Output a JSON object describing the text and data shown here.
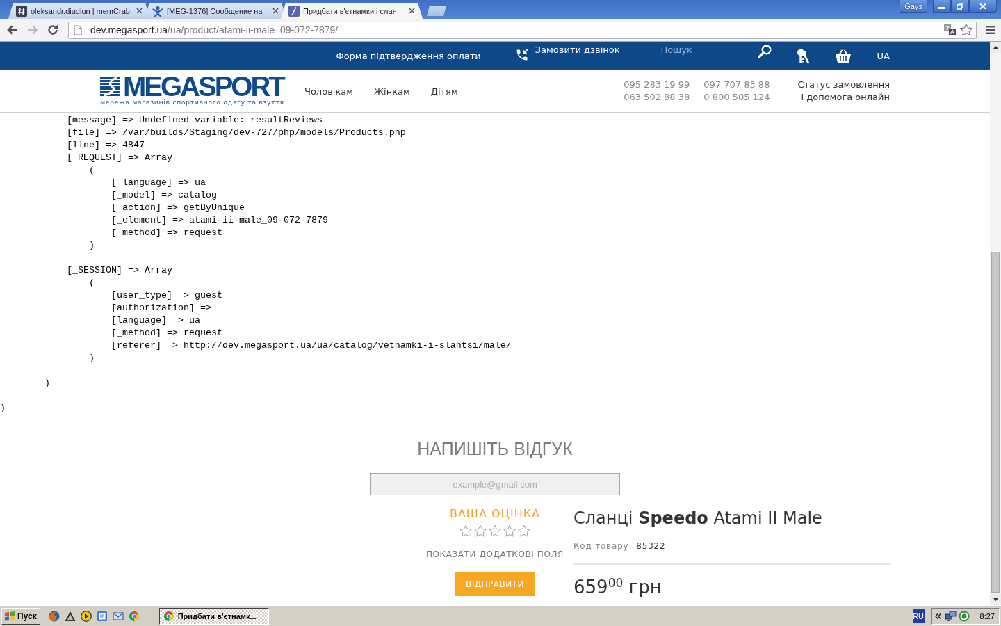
{
  "browser": {
    "tabs": [
      {
        "title": "oleksandr.diudiun | memCrab",
        "selected": false
      },
      {
        "title": "[MEG-1376] Сообщение на",
        "selected": false
      },
      {
        "title": "Придбати в'єтнамки і слан",
        "selected": true
      }
    ],
    "profile": "Gays",
    "nav_buttons": [
      {
        "kind": "back",
        "disabled": false
      },
      {
        "kind": "forward",
        "disabled": true
      },
      {
        "kind": "reload",
        "disabled": false
      }
    ],
    "address": {
      "host": "dev.megasport.ua",
      "path": "/ua/product/atami-ii-male_09-072-7879/"
    }
  },
  "site_header": {
    "top_bar": {
      "payment_form_link": "Форма підтвердження оплати",
      "callback_link": "Замовити дзвінок",
      "search": {
        "placeholder": "Пошук"
      },
      "language": "UA"
    },
    "logo": {
      "wordmark": "MEGASPORT",
      "tagline": "мережа магазинів спортивного одягу та взуття"
    },
    "nav": [
      "Чоловікам",
      "Жінкам",
      "Дітям"
    ],
    "phone_columns": [
      [
        "095 283 19 99",
        "063 502 88 38"
      ],
      [
        "097 707 83 88",
        "0 800 505 124"
      ]
    ],
    "support_link": [
      "Статус замовлення",
      "і допомога онлайн"
    ]
  },
  "debug_dump": {
    "children": [
      {
        "children": [
          {
            "text": "[message] => Undefined variable: resultReviews"
          },
          {
            "text": "[file] => /var/builds/Staging/dev-727/php/models/Products.php"
          },
          {
            "text": "[line] => 4847"
          },
          {
            "text": "[_REQUEST] => Array",
            "open": "(",
            "close": ")",
            "children": [
              {
                "text": "[_language] => ua"
              },
              {
                "text": "[_model] => catalog"
              },
              {
                "text": "[_action] => getByUnique"
              },
              {
                "text": "[_element] => atami-ii-male_09-072-7879"
              },
              {
                "text": "[_method] => request"
              }
            ]
          },
          {
            "text": "[_SESSION] => Array",
            "open": "(",
            "close": ")",
            "children": [
              {
                "text": "[user_type] => guest"
              },
              {
                "text": "[authorization] =>"
              },
              {
                "text": "[language] => ua"
              },
              {
                "text": "[_method] => request"
              },
              {
                "text": "[referer] => http://dev.megasport.ua/ua/catalog/vetnamki-i-slantsi/male/"
              }
            ]
          }
        ],
        "close": ")"
      }
    ],
    "close": ")"
  },
  "review_form": {
    "title": "НАПИШІТЬ ВІДГУК",
    "email": {
      "placeholder": "example@gmail.com"
    },
    "rating_label": "ВАША ОЦІНКА",
    "stars": 0,
    "more_fields_link": "ПОКАЗАТИ ДОДАТКОВІ ПОЛЯ",
    "submit": "ВІДПРАВИТИ"
  },
  "product": {
    "title": "Сланці **Speedo** Atami II Male",
    "code_label": "Код товару:",
    "code": "85322",
    "price": "659$^{00}$ грн"
  },
  "taskbar": {
    "start": "Пуск",
    "tasks": [
      {
        "title": "Придбати в'єтнамк...",
        "selected": true
      }
    ],
    "language": "RU",
    "clock": "8:27"
  }
}
